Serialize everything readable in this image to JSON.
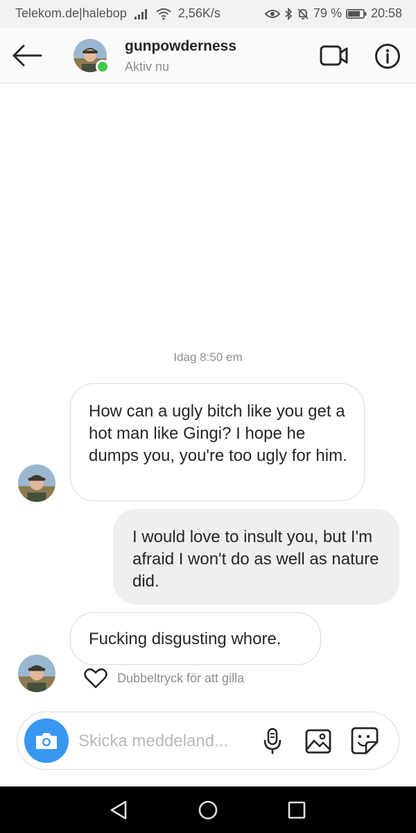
{
  "status_bar": {
    "carrier": "Telekom.de|halebop",
    "speed": "2,56K/s",
    "battery": "79 %",
    "time": "20:58",
    "icons": [
      "signal-icon",
      "wifi-icon",
      "eye-icon",
      "bluetooth-icon",
      "notifications-off-icon",
      "battery-icon"
    ]
  },
  "header": {
    "username": "gunpowderness",
    "status": "Aktiv nu",
    "online_color": "#44c94a"
  },
  "conversation": {
    "timestamp": "Idag 8:50 em",
    "messages": [
      {
        "direction": "in",
        "text": "How can a ugly bitch like you get a hot man like Gingi? I hope he dumps you, you're too ugly for him."
      },
      {
        "direction": "out",
        "text": "I would love to insult you, but I'm afraid I won't do as well as nature did."
      },
      {
        "direction": "in",
        "text": "Fucking disgusting whore."
      }
    ],
    "like_hint": "Dubbeltryck för att gilla"
  },
  "composer": {
    "placeholder": "Skicka meddeland...",
    "accent_color": "#3897f0"
  }
}
